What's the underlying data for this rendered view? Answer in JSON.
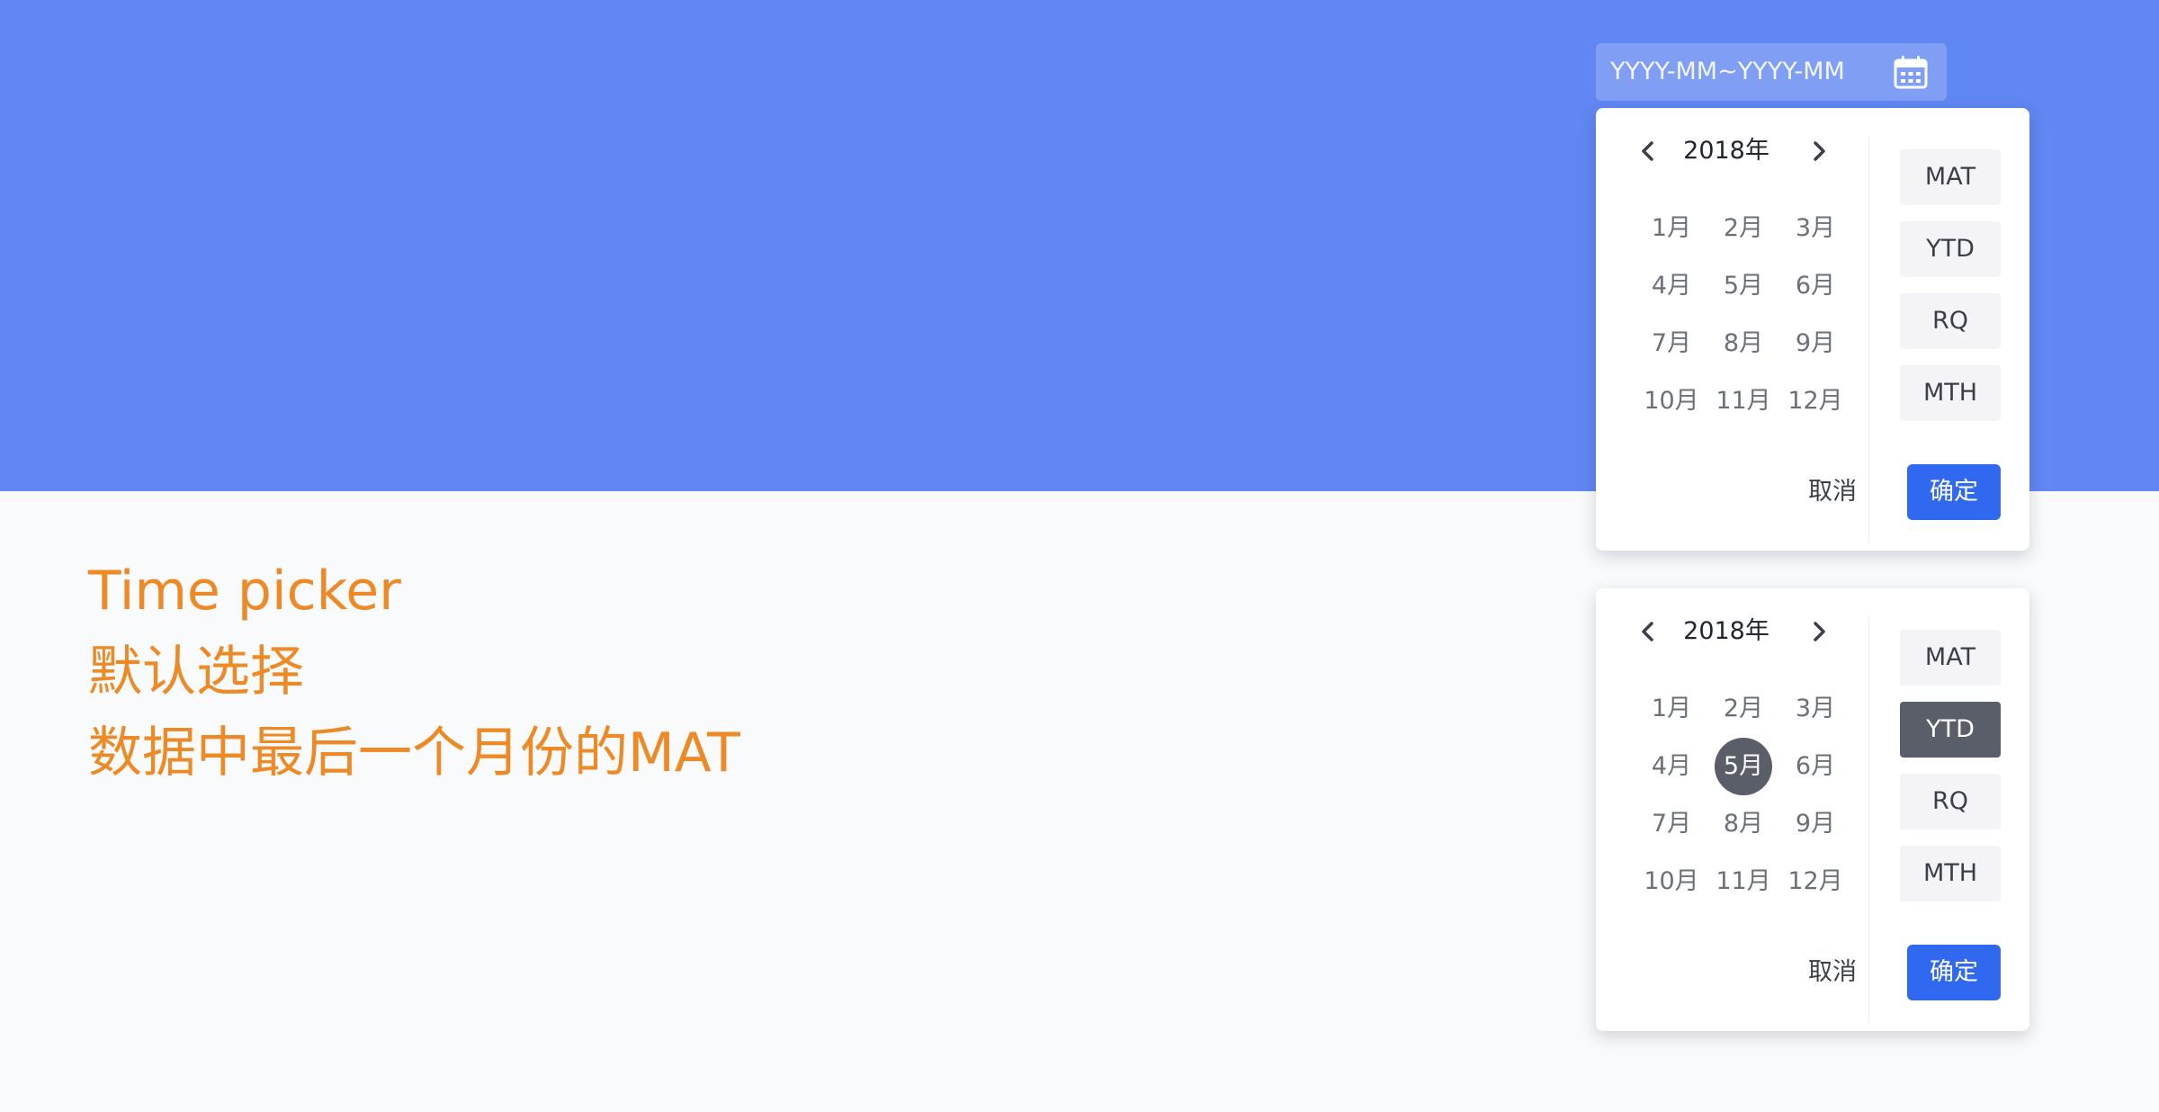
{
  "range_input": {
    "placeholder": "YYYY-MM~YYYY-MM",
    "icon": "calendar-icon"
  },
  "caption": {
    "line1": "Time picker",
    "line2": "默认选择",
    "line3": "数据中最后一个月份的MAT"
  },
  "pickers": [
    {
      "year": "2018年",
      "months": [
        "1月",
        "2月",
        "3月",
        "4月",
        "5月",
        "6月",
        "7月",
        "8月",
        "9月",
        "10月",
        "11月",
        "12月"
      ],
      "selected_month": null,
      "periods": [
        "MAT",
        "YTD",
        "RQ",
        "MTH"
      ],
      "selected_period": null,
      "cancel_label": "取消",
      "confirm_label": "确定"
    },
    {
      "year": "2018年",
      "months": [
        "1月",
        "2月",
        "3月",
        "4月",
        "5月",
        "6月",
        "7月",
        "8月",
        "9月",
        "10月",
        "11月",
        "12月"
      ],
      "selected_month": "5月",
      "periods": [
        "MAT",
        "YTD",
        "RQ",
        "MTH"
      ],
      "selected_period": "YTD",
      "cancel_label": "取消",
      "confirm_label": "确定"
    }
  ],
  "colors": {
    "hero_background": "#6187f2",
    "page_background": "#f9fafb",
    "caption_text": "#ee8a26",
    "confirm_button": "#3068f0",
    "selected_fill": "#595e69"
  }
}
